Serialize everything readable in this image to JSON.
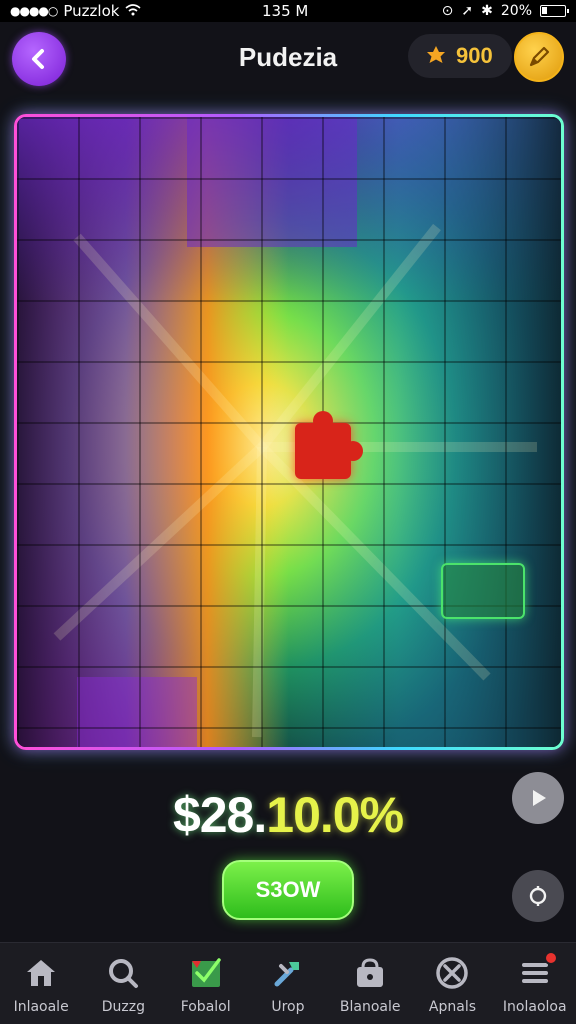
{
  "status_bar": {
    "carrier": "Puzzlok",
    "time": "135 M",
    "battery": "20%"
  },
  "header": {
    "title": "Pudezia",
    "coins": "900"
  },
  "score": {
    "part_a": "$28.",
    "part_b": "10.0%"
  },
  "action_button": {
    "label": "S3OW"
  },
  "bottom_nav": {
    "items": [
      {
        "label": "Inlaoale",
        "icon": "home-icon"
      },
      {
        "label": "Duzzg",
        "icon": "search-icon"
      },
      {
        "label": "Fobalol",
        "icon": "flag-icon"
      },
      {
        "label": "Urop",
        "icon": "tools-icon"
      },
      {
        "label": "Blanoale",
        "icon": "shop-icon"
      },
      {
        "label": "Apnals",
        "icon": "compass-icon"
      },
      {
        "label": "Inolaoloa",
        "icon": "menu-icon"
      }
    ]
  },
  "colors": {
    "accent_purple": "#8a2be2",
    "coin_gold": "#f5c23a",
    "action_green": "#2ebd1c",
    "badge_red": "#e8322e"
  }
}
